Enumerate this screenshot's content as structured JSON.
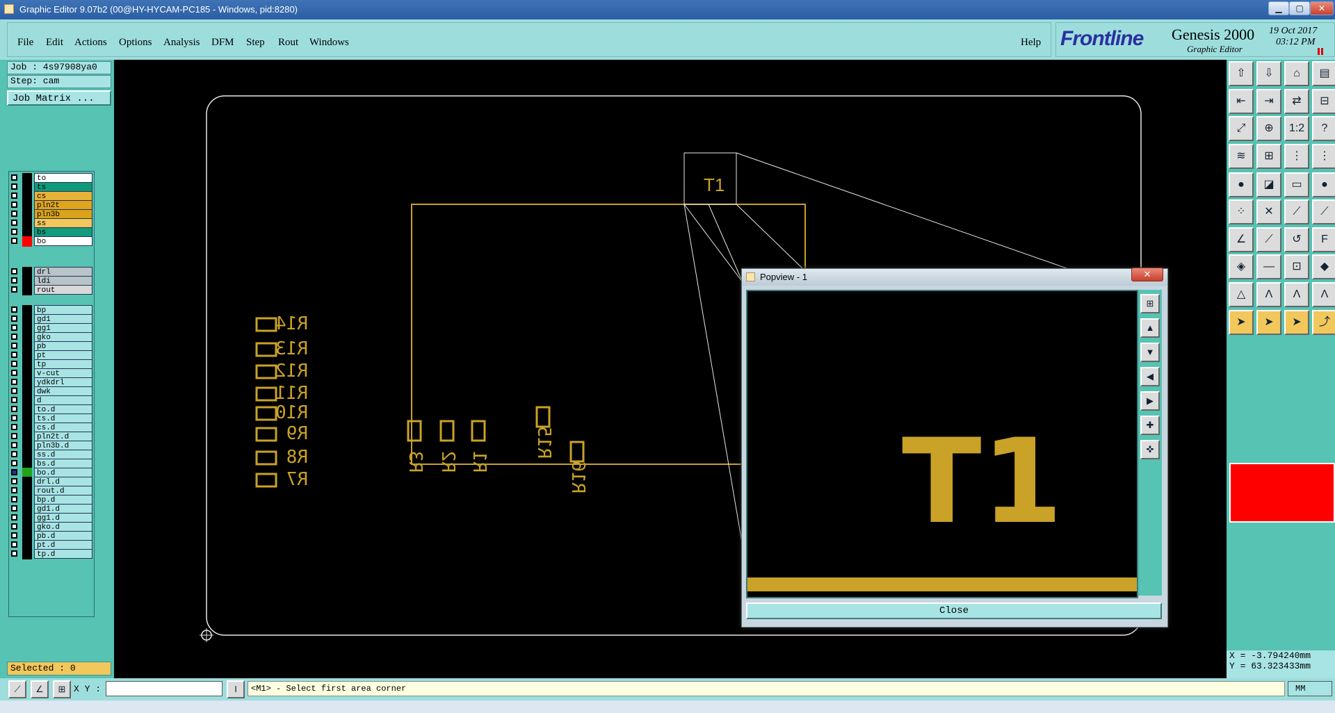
{
  "window": {
    "title": "Graphic Editor 9.07b2 (00@HY-HYCAM-PC185 - Windows, pid:8280)"
  },
  "menu": [
    "File",
    "Edit",
    "Actions",
    "Options",
    "Analysis",
    "DFM",
    "Step",
    "Rout",
    "Windows"
  ],
  "help_label": "Help",
  "brand": {
    "logo": "Frontline",
    "product": "Genesis 2000",
    "subtitle": "Graphic Editor",
    "date": "19 Oct 2017",
    "time": "03:12 PM"
  },
  "job": {
    "job_label": "Job : 4s97908ya0",
    "step_label": "Step: cam",
    "matrix_button": "Job Matrix ..."
  },
  "layers": {
    "group1": [
      {
        "name": "to",
        "color": "#ffffff"
      },
      {
        "name": "ts",
        "color": "#0f9a7a"
      },
      {
        "name": "cs",
        "color": "#e9b23a"
      },
      {
        "name": "pln2t",
        "color": "#e0a51c"
      },
      {
        "name": "pln3b",
        "color": "#d9a31b"
      },
      {
        "name": "ss",
        "color": "#f2c75b"
      },
      {
        "name": "bs",
        "color": "#139b7b"
      },
      {
        "name": "bo",
        "color": "#ffffff",
        "swatch": "#ff0000"
      }
    ],
    "group2": [
      {
        "name": "drl",
        "color": "#b9c4c9"
      },
      {
        "name": "ldi",
        "color": "#b9c4c9"
      },
      {
        "name": "rout",
        "color": "#d8d8d8"
      }
    ],
    "group3": [
      {
        "name": "bp"
      },
      {
        "name": "gd1"
      },
      {
        "name": "gg1"
      },
      {
        "name": "gko"
      },
      {
        "name": "pb"
      },
      {
        "name": "pt"
      },
      {
        "name": "tp"
      },
      {
        "name": "v-cut"
      },
      {
        "name": "ydkdrl"
      },
      {
        "name": "dwk"
      },
      {
        "name": "d"
      },
      {
        "name": "to.d"
      },
      {
        "name": "ts.d"
      },
      {
        "name": "cs.d"
      },
      {
        "name": "pln2t.d"
      },
      {
        "name": "pln3b.d"
      },
      {
        "name": "ss.d"
      },
      {
        "name": "bs.d"
      },
      {
        "name": "bo.d",
        "swatch": "#23a21c",
        "active": true
      },
      {
        "name": "drl.d"
      },
      {
        "name": "rout.d"
      },
      {
        "name": "bp.d"
      },
      {
        "name": "gd1.d"
      },
      {
        "name": "gg1.d"
      },
      {
        "name": "gko.d"
      },
      {
        "name": "pb.d"
      },
      {
        "name": "pt.d"
      },
      {
        "name": "tp.d"
      }
    ]
  },
  "selected_label": "Selected : 0",
  "canvas": {
    "silk_labels": [
      "R14",
      "R13",
      "R12",
      "R11",
      "R10",
      "R9",
      "R8",
      "R7",
      "R3",
      "R2",
      "R1",
      "R15",
      "R16"
    ],
    "zoom_label": "T1"
  },
  "popview": {
    "title": "Popview - 1",
    "label": "T1",
    "close_button": "Close"
  },
  "coords": {
    "x": "X = -3.794240mm",
    "y": "Y = 63.323433mm"
  },
  "statusbar": {
    "xy_label": "X Y :",
    "xy_value": "",
    "prompt": "<M1> - Select first area corner",
    "units": "MM"
  },
  "colors": {
    "accent": "#9ddedd",
    "panel": "#56c3b3",
    "trace": "#c9a227",
    "outline": "#e8e8e8",
    "highlight": "#ff0000"
  }
}
